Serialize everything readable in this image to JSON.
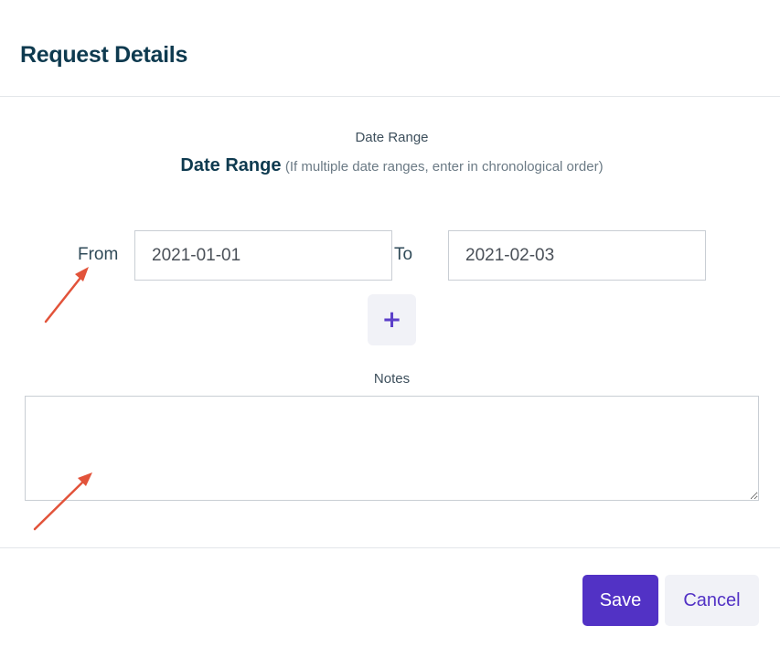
{
  "dialog": {
    "title": "Request Details"
  },
  "date_range": {
    "small_label": "Date Range",
    "heading": "Date Range",
    "hint": "(If multiple date ranges, enter in chronological order)",
    "from_label": "From",
    "from_value": "2021-01-01",
    "to_label": "To",
    "to_value": "2021-02-03",
    "add_icon": "plus-icon",
    "add_glyph": "+"
  },
  "notes": {
    "label": "Notes",
    "value": ""
  },
  "footer": {
    "save_label": "Save",
    "cancel_label": "Cancel"
  },
  "colors": {
    "primary": "#5232c5",
    "title": "#0e3a4f",
    "annotation_arrow": "#e2533a"
  }
}
